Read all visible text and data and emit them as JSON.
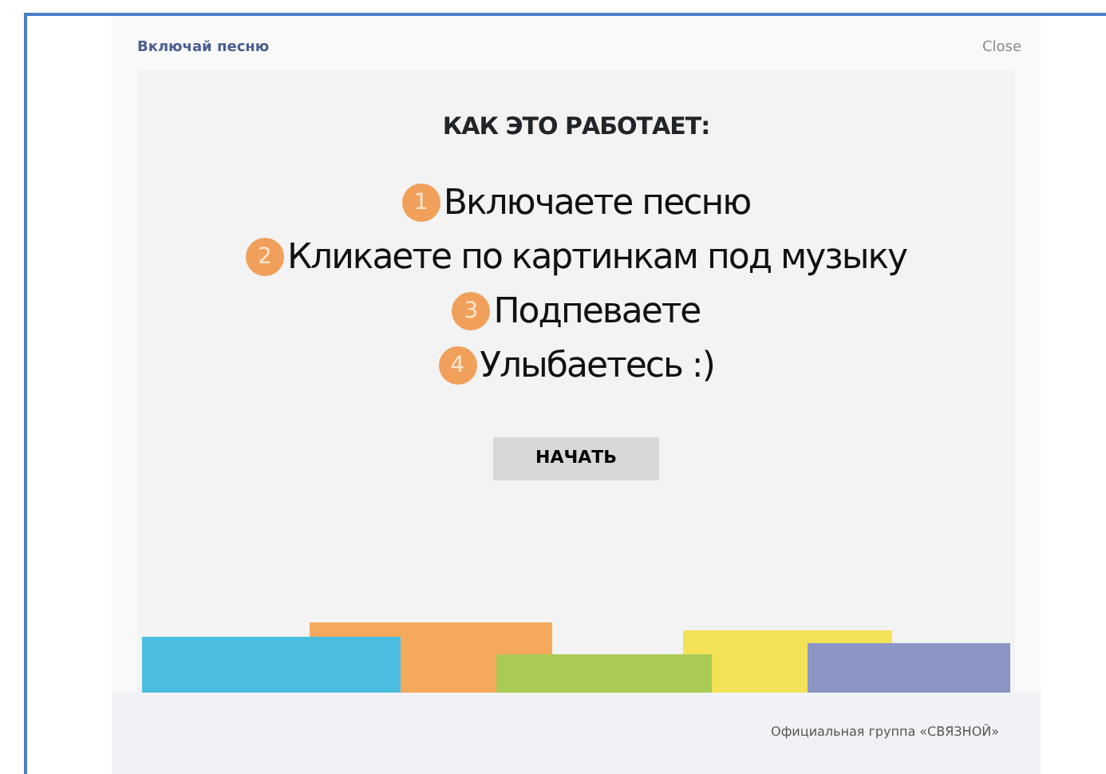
{
  "dialog": {
    "title": "Включай песню",
    "close": "Close"
  },
  "heading": "КАК ЭТО РАБОТАЕТ:",
  "steps": [
    {
      "number": "1",
      "text": "Включаете песню"
    },
    {
      "number": "2",
      "text": "Кликаете по картинкам под музыку"
    },
    {
      "number": "3",
      "text": "Подпеваете"
    },
    {
      "number": "4",
      "text": "Улыбаетесь :)"
    }
  ],
  "start_button": "НАЧАТЬ",
  "footer": "Официальная группа «СВЯЗНОЙ»"
}
